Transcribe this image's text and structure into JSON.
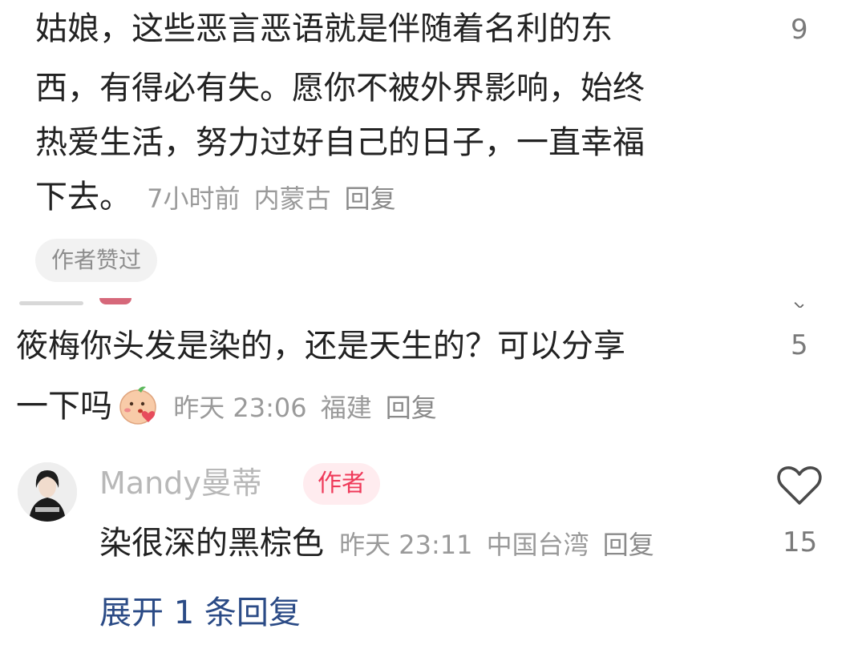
{
  "comment1": {
    "lines": [
      "姑娘，这些恶言恶语就是伴随着名利的东",
      "西，有得必有失。愿你不被外界影响，始终",
      "热爱生活，努力过好自己的日子，一直幸福",
      "下去。"
    ],
    "time": "7小时前",
    "location": "内蒙古",
    "reply_label": "回复",
    "like_count": "9",
    "liked_badge": "作者赞过"
  },
  "comment2": {
    "lines": [
      "筱梅你头发是染的，还是天生的？可以分享",
      "一下吗"
    ],
    "emoji": "kiss-blush-emoji",
    "time": "昨天 23:06",
    "location": "福建",
    "reply_label": "回复",
    "like_count": "5"
  },
  "reply": {
    "author": "Mandy曼蒂",
    "author_badge": "作者",
    "text": "染很深的黑棕色",
    "time": "昨天 23:11",
    "location": "中国台湾",
    "reply_label": "回复",
    "like_count": "15",
    "heart_icon": "heart-outline-icon"
  },
  "expand_label": "展开 1 条回复",
  "colors": {
    "text": "#222222",
    "meta": "#9a9a9a",
    "author_badge_bg": "#ffecef",
    "author_badge_text": "#ef3a5a",
    "expand_link": "#2b4b86"
  }
}
